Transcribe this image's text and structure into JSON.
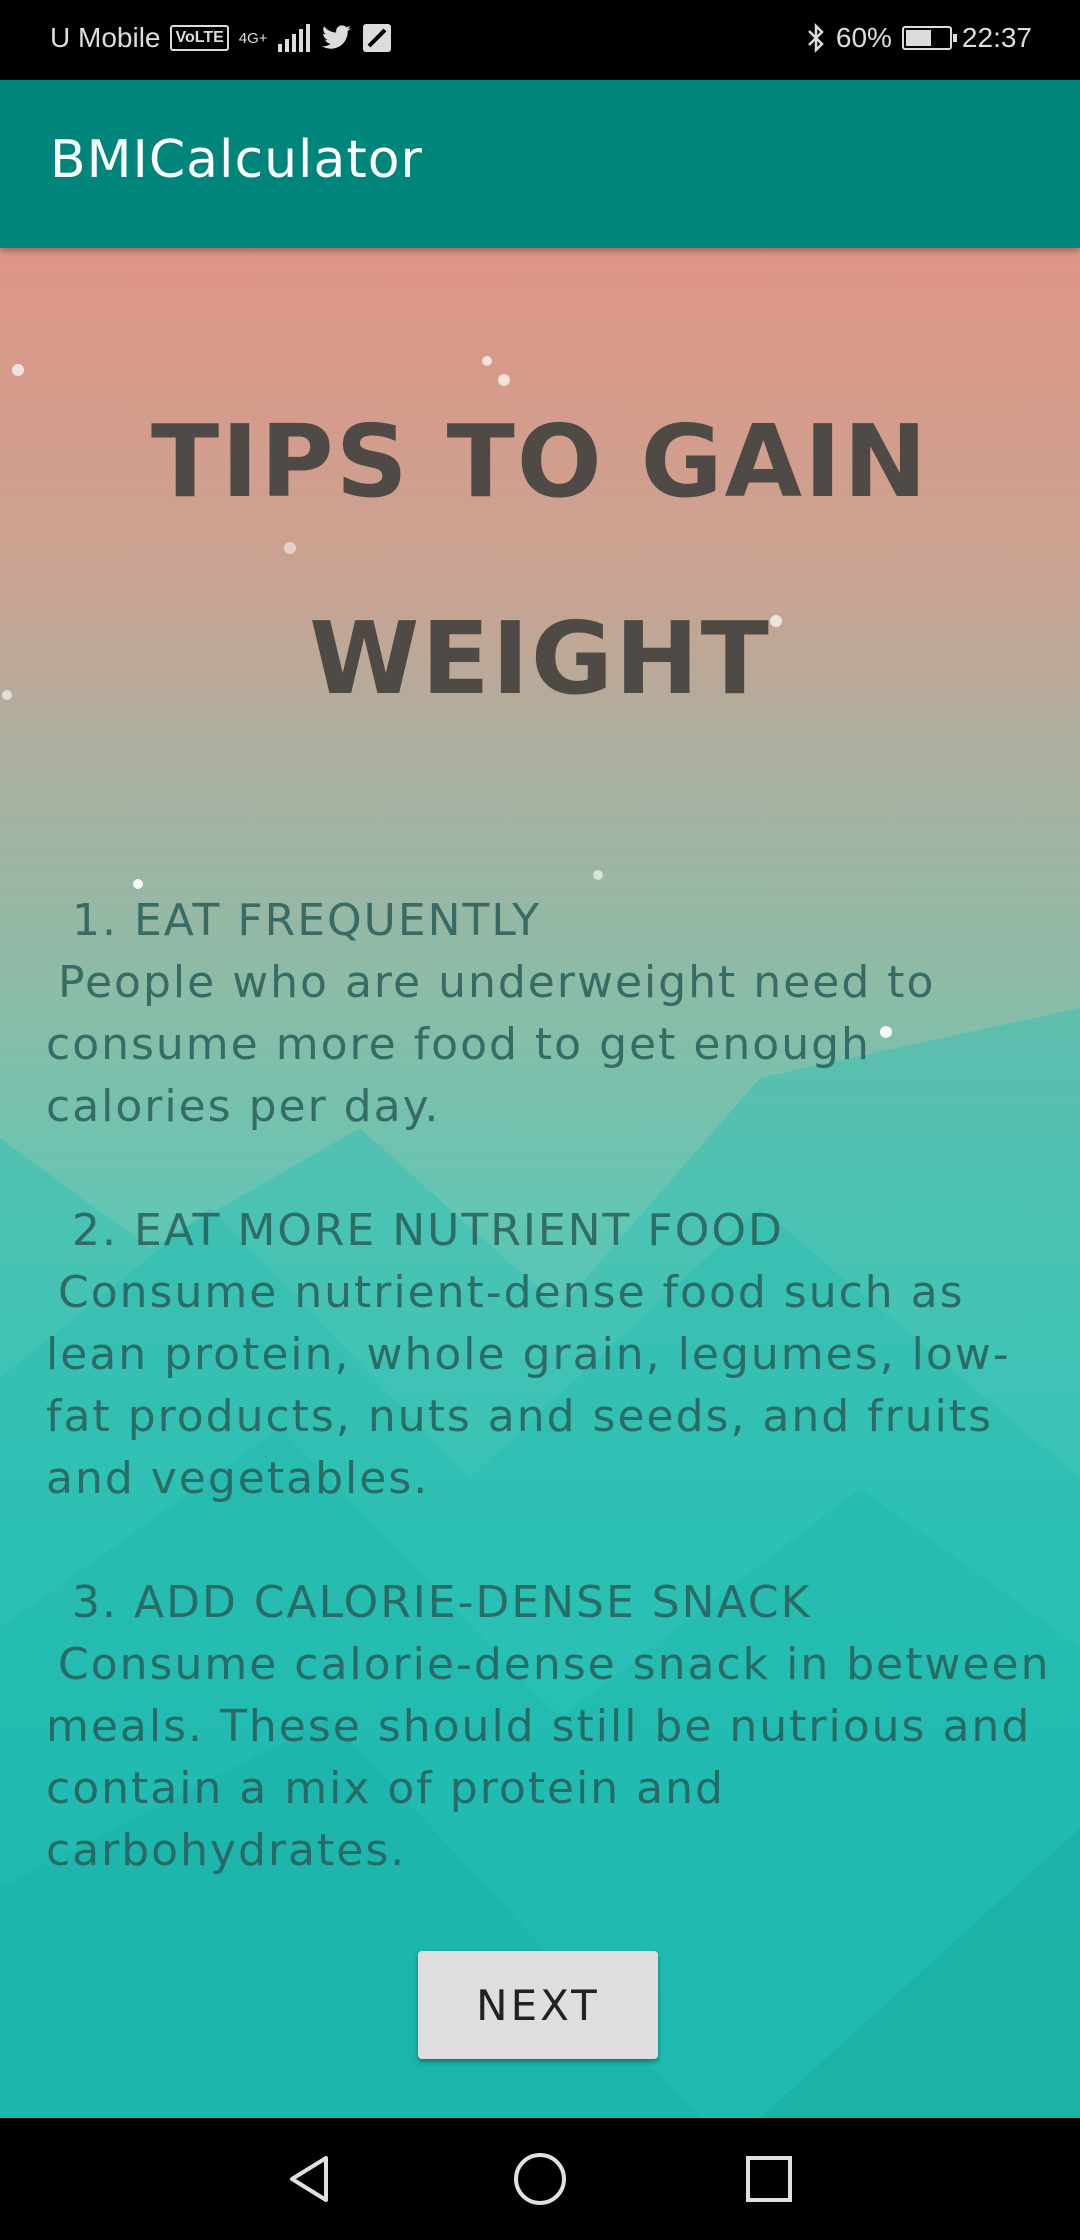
{
  "status_bar": {
    "carrier": "U Mobile",
    "volte": "VoLTE",
    "network": "4G+",
    "battery": "60%",
    "battery_level": 0.6,
    "time": "22:37",
    "icons": [
      "volte-icon",
      "signal-icon",
      "twitter-icon",
      "notification-icon",
      "bluetooth-icon",
      "battery-charging-icon"
    ]
  },
  "app_bar": {
    "title": "BMICalculator",
    "color": "#00857a"
  },
  "page": {
    "heading_line1": "TIPS TO GAIN",
    "heading_line2": "WEIGHT",
    "tips": [
      {
        "title": "1. EAT FREQUENTLY",
        "body": "People who are underweight need to consume more food to get enough calories per day."
      },
      {
        "title": "2. EAT MORE NUTRIENT FOOD",
        "body": "Consume nutrient-dense food such as lean protein, whole grain, legumes, low-fat products, nuts and seeds, and fruits and vegetables."
      },
      {
        "title": "3. ADD CALORIE-DENSE SNACK",
        "body": "Consume calorie-dense snack in between meals. These should still be nutrious and contain a mix of protein and carbohydrates."
      }
    ],
    "next_label": "NEXT"
  },
  "nav_bar": {
    "icons": [
      "back-icon",
      "home-icon",
      "recents-icon"
    ]
  }
}
